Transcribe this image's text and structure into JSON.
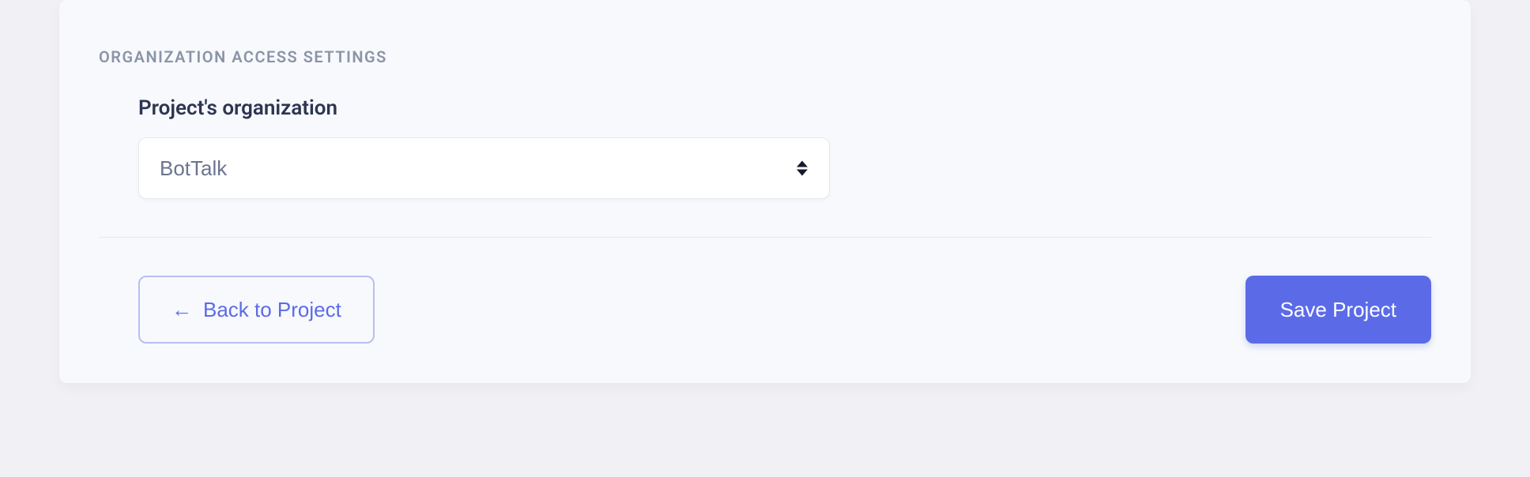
{
  "section": {
    "title": "ORGANIZATION ACCESS SETTINGS"
  },
  "form": {
    "org_field": {
      "label": "Project's organization",
      "selected": "BotTalk"
    }
  },
  "actions": {
    "back_label": "Back to Project",
    "back_arrow": "←",
    "save_label": "Save Project"
  }
}
